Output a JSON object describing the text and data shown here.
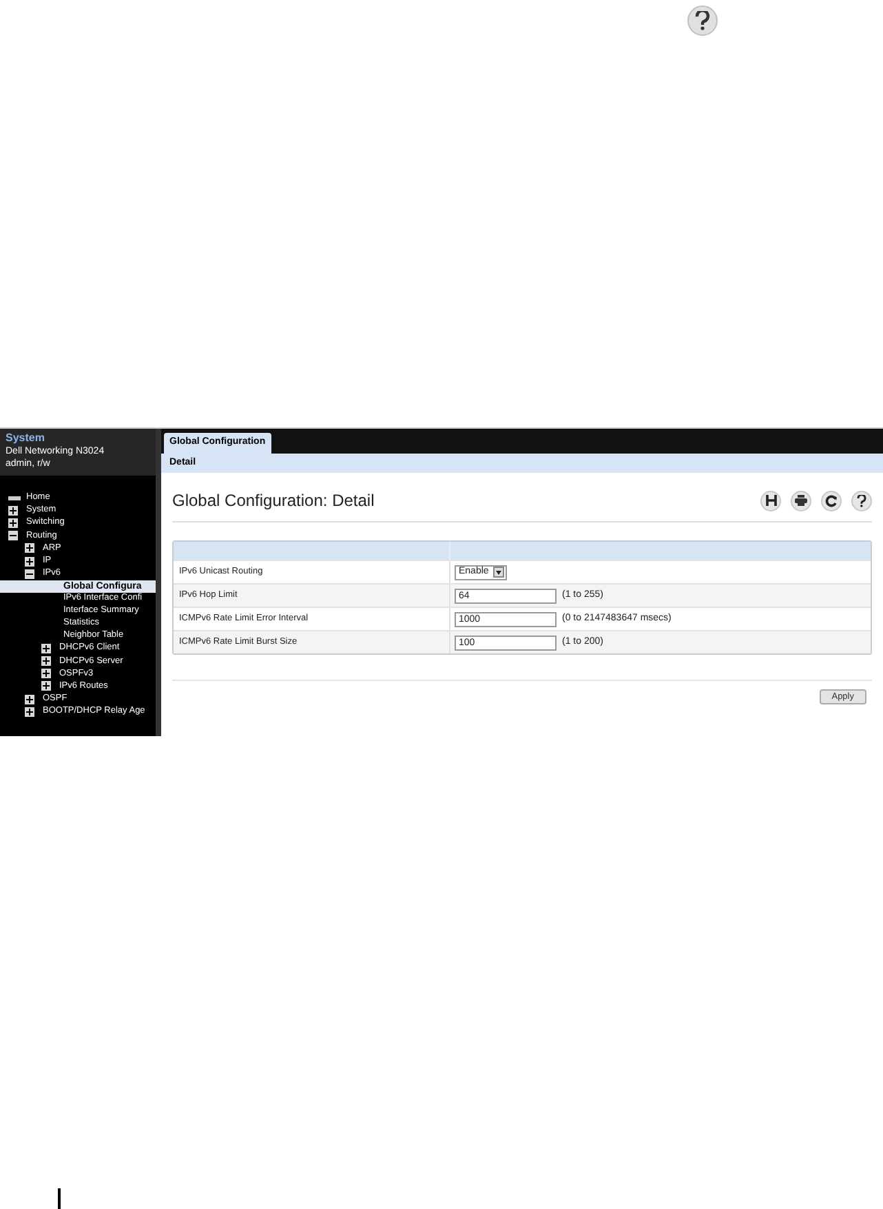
{
  "sidebar": {
    "title": "System",
    "device": "Dell Networking N3024",
    "user": "admin, r/w",
    "tree": [
      {
        "label": "Home",
        "kind": "home"
      },
      {
        "label": "System",
        "kind": "folder",
        "expanded": false
      },
      {
        "label": "Switching",
        "kind": "folder",
        "expanded": false
      },
      {
        "label": "Routing",
        "kind": "folder",
        "expanded": true,
        "children": [
          {
            "label": "ARP",
            "kind": "folder",
            "expanded": false
          },
          {
            "label": "IP",
            "kind": "folder",
            "expanded": false
          },
          {
            "label": "IPv6",
            "kind": "folder",
            "expanded": true,
            "children": [
              {
                "label": "Global Configura",
                "kind": "page",
                "selected": true
              },
              {
                "label": "IPv6 Interface Confi",
                "kind": "page",
                "selected": false
              },
              {
                "label": "Interface Summary",
                "kind": "page",
                "selected": false
              },
              {
                "label": "Statistics",
                "kind": "page",
                "selected": false
              },
              {
                "label": "Neighbor Table",
                "kind": "page",
                "selected": false
              },
              {
                "label": "DHCPv6 Client",
                "kind": "folder",
                "expanded": false
              },
              {
                "label": "DHCPv6 Server",
                "kind": "folder",
                "expanded": false
              },
              {
                "label": "OSPFv3",
                "kind": "folder",
                "expanded": false
              },
              {
                "label": "IPv6 Routes",
                "kind": "folder",
                "expanded": false
              }
            ]
          },
          {
            "label": "OSPF",
            "kind": "folder",
            "expanded": false
          },
          {
            "label": "BOOTP/DHCP Relay Age",
            "kind": "folder",
            "expanded": false
          }
        ]
      }
    ]
  },
  "tabs": [
    {
      "label": "Global Configuration",
      "selected": true
    }
  ],
  "subtabs": [
    {
      "label": "Detail",
      "selected": true
    }
  ],
  "page_title": "Global Configuration: Detail",
  "fields": [
    {
      "label": "IPv6 Unicast Routing",
      "kind": "select",
      "value": "Enable"
    },
    {
      "label": "IPv6 Hop Limit",
      "kind": "text",
      "value": "64",
      "hint": "(1 to 255)"
    },
    {
      "label": "ICMPv6 Rate Limit Error Interval",
      "kind": "text",
      "value": "1000",
      "hint": "(0 to 2147483647 msecs)"
    },
    {
      "label": "ICMPv6 Rate Limit Burst Size",
      "kind": "text",
      "value": "100",
      "hint": "(1 to 200)"
    }
  ],
  "apply_button": "Apply"
}
